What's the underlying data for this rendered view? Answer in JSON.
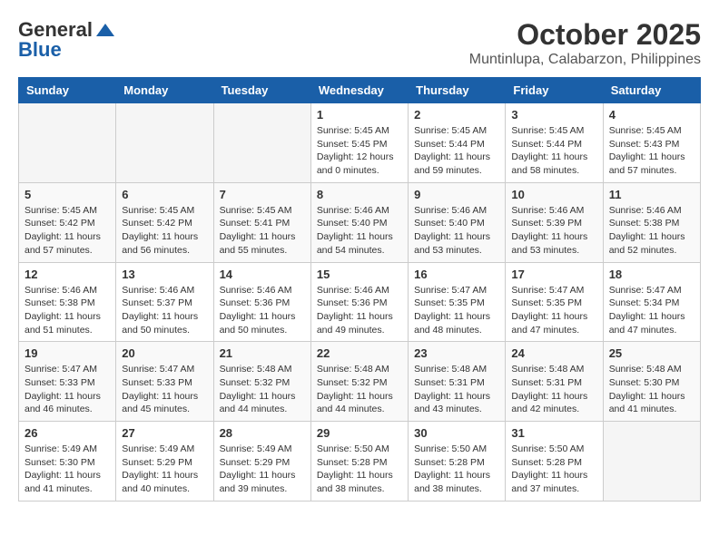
{
  "header": {
    "logo_general": "General",
    "logo_blue": "Blue",
    "title": "October 2025",
    "subtitle": "Muntinlupa, Calabarzon, Philippines"
  },
  "weekdays": [
    "Sunday",
    "Monday",
    "Tuesday",
    "Wednesday",
    "Thursday",
    "Friday",
    "Saturday"
  ],
  "weeks": [
    [
      {
        "day": null,
        "info": null
      },
      {
        "day": null,
        "info": null
      },
      {
        "day": null,
        "info": null
      },
      {
        "day": "1",
        "info": "Sunrise: 5:45 AM\nSunset: 5:45 PM\nDaylight: 12 hours\nand 0 minutes."
      },
      {
        "day": "2",
        "info": "Sunrise: 5:45 AM\nSunset: 5:44 PM\nDaylight: 11 hours\nand 59 minutes."
      },
      {
        "day": "3",
        "info": "Sunrise: 5:45 AM\nSunset: 5:44 PM\nDaylight: 11 hours\nand 58 minutes."
      },
      {
        "day": "4",
        "info": "Sunrise: 5:45 AM\nSunset: 5:43 PM\nDaylight: 11 hours\nand 57 minutes."
      }
    ],
    [
      {
        "day": "5",
        "info": "Sunrise: 5:45 AM\nSunset: 5:42 PM\nDaylight: 11 hours\nand 57 minutes."
      },
      {
        "day": "6",
        "info": "Sunrise: 5:45 AM\nSunset: 5:42 PM\nDaylight: 11 hours\nand 56 minutes."
      },
      {
        "day": "7",
        "info": "Sunrise: 5:45 AM\nSunset: 5:41 PM\nDaylight: 11 hours\nand 55 minutes."
      },
      {
        "day": "8",
        "info": "Sunrise: 5:46 AM\nSunset: 5:40 PM\nDaylight: 11 hours\nand 54 minutes."
      },
      {
        "day": "9",
        "info": "Sunrise: 5:46 AM\nSunset: 5:40 PM\nDaylight: 11 hours\nand 53 minutes."
      },
      {
        "day": "10",
        "info": "Sunrise: 5:46 AM\nSunset: 5:39 PM\nDaylight: 11 hours\nand 53 minutes."
      },
      {
        "day": "11",
        "info": "Sunrise: 5:46 AM\nSunset: 5:38 PM\nDaylight: 11 hours\nand 52 minutes."
      }
    ],
    [
      {
        "day": "12",
        "info": "Sunrise: 5:46 AM\nSunset: 5:38 PM\nDaylight: 11 hours\nand 51 minutes."
      },
      {
        "day": "13",
        "info": "Sunrise: 5:46 AM\nSunset: 5:37 PM\nDaylight: 11 hours\nand 50 minutes."
      },
      {
        "day": "14",
        "info": "Sunrise: 5:46 AM\nSunset: 5:36 PM\nDaylight: 11 hours\nand 50 minutes."
      },
      {
        "day": "15",
        "info": "Sunrise: 5:46 AM\nSunset: 5:36 PM\nDaylight: 11 hours\nand 49 minutes."
      },
      {
        "day": "16",
        "info": "Sunrise: 5:47 AM\nSunset: 5:35 PM\nDaylight: 11 hours\nand 48 minutes."
      },
      {
        "day": "17",
        "info": "Sunrise: 5:47 AM\nSunset: 5:35 PM\nDaylight: 11 hours\nand 47 minutes."
      },
      {
        "day": "18",
        "info": "Sunrise: 5:47 AM\nSunset: 5:34 PM\nDaylight: 11 hours\nand 47 minutes."
      }
    ],
    [
      {
        "day": "19",
        "info": "Sunrise: 5:47 AM\nSunset: 5:33 PM\nDaylight: 11 hours\nand 46 minutes."
      },
      {
        "day": "20",
        "info": "Sunrise: 5:47 AM\nSunset: 5:33 PM\nDaylight: 11 hours\nand 45 minutes."
      },
      {
        "day": "21",
        "info": "Sunrise: 5:48 AM\nSunset: 5:32 PM\nDaylight: 11 hours\nand 44 minutes."
      },
      {
        "day": "22",
        "info": "Sunrise: 5:48 AM\nSunset: 5:32 PM\nDaylight: 11 hours\nand 44 minutes."
      },
      {
        "day": "23",
        "info": "Sunrise: 5:48 AM\nSunset: 5:31 PM\nDaylight: 11 hours\nand 43 minutes."
      },
      {
        "day": "24",
        "info": "Sunrise: 5:48 AM\nSunset: 5:31 PM\nDaylight: 11 hours\nand 42 minutes."
      },
      {
        "day": "25",
        "info": "Sunrise: 5:48 AM\nSunset: 5:30 PM\nDaylight: 11 hours\nand 41 minutes."
      }
    ],
    [
      {
        "day": "26",
        "info": "Sunrise: 5:49 AM\nSunset: 5:30 PM\nDaylight: 11 hours\nand 41 minutes."
      },
      {
        "day": "27",
        "info": "Sunrise: 5:49 AM\nSunset: 5:29 PM\nDaylight: 11 hours\nand 40 minutes."
      },
      {
        "day": "28",
        "info": "Sunrise: 5:49 AM\nSunset: 5:29 PM\nDaylight: 11 hours\nand 39 minutes."
      },
      {
        "day": "29",
        "info": "Sunrise: 5:50 AM\nSunset: 5:28 PM\nDaylight: 11 hours\nand 38 minutes."
      },
      {
        "day": "30",
        "info": "Sunrise: 5:50 AM\nSunset: 5:28 PM\nDaylight: 11 hours\nand 38 minutes."
      },
      {
        "day": "31",
        "info": "Sunrise: 5:50 AM\nSunset: 5:28 PM\nDaylight: 11 hours\nand 37 minutes."
      },
      {
        "day": null,
        "info": null
      }
    ]
  ]
}
